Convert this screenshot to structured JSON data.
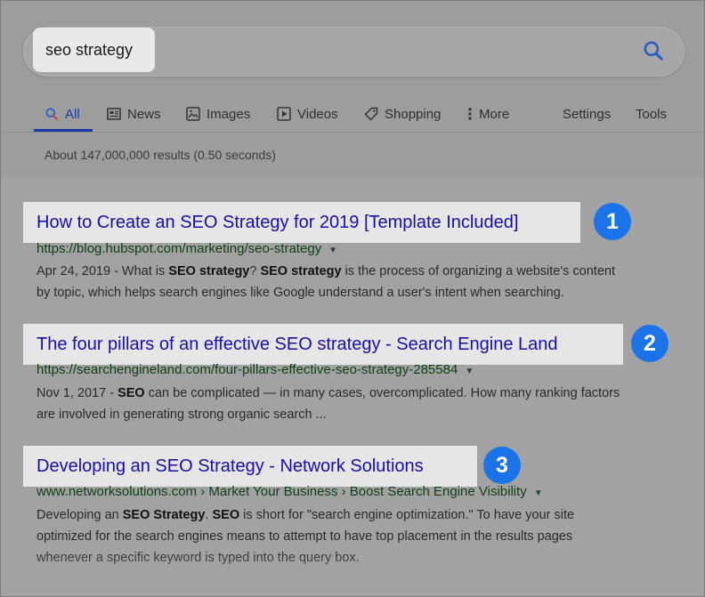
{
  "search": {
    "query": "seo strategy"
  },
  "tabs": {
    "all": "All",
    "news": "News",
    "images": "Images",
    "videos": "Videos",
    "shopping": "Shopping",
    "more": "More",
    "settings": "Settings",
    "tools": "Tools"
  },
  "stats": "About 147,000,000 results (0.50 seconds)",
  "results": [
    {
      "badge": "1",
      "title": "How to Create an SEO Strategy for 2019 [Template Included]",
      "url": "https://blog.hubspot.com/marketing/seo-strategy",
      "snippet": {
        "line1": {
          "p1": "Apr 24, 2019 - What is ",
          "b1": "SEO strategy",
          "p2": "? ",
          "b2": "SEO strategy",
          "p3": " is the process of organizing a website's content"
        },
        "line2": "by topic, which helps search engines like Google understand a user's intent when searching."
      }
    },
    {
      "badge": "2",
      "title": "The four pillars of an effective SEO strategy - Search Engine Land",
      "url": "https://searchengineland.com/four-pillars-effective-seo-strategy-285584",
      "snippet": {
        "line1": {
          "p1": "Nov 1, 2017 - ",
          "b1": "SEO",
          "p2": " can be complicated — in many cases, overcomplicated. How many ranking factors"
        },
        "line2": "are involved in generating strong organic search ..."
      }
    },
    {
      "badge": "3",
      "title": "Developing an SEO Strategy - Network Solutions",
      "url": "www.networksolutions.com › Market Your Business › Boost Search Engine Visibility",
      "snippet": {
        "line1": {
          "p1": "Developing an ",
          "b1": "SEO Strategy",
          "p2": ". ",
          "b2": "SEO",
          "p3": " is short for \"search engine optimization.\" To have your site"
        },
        "line2": "optimized for the search engines means to attempt to have top placement in the results pages",
        "line3": "whenever a specific keyword is typed into the query box."
      }
    }
  ],
  "colors": {
    "link": "#1a0dab",
    "url": "#10401a",
    "badge": "#1a73e8",
    "active_tab": "#1a3aa8"
  }
}
